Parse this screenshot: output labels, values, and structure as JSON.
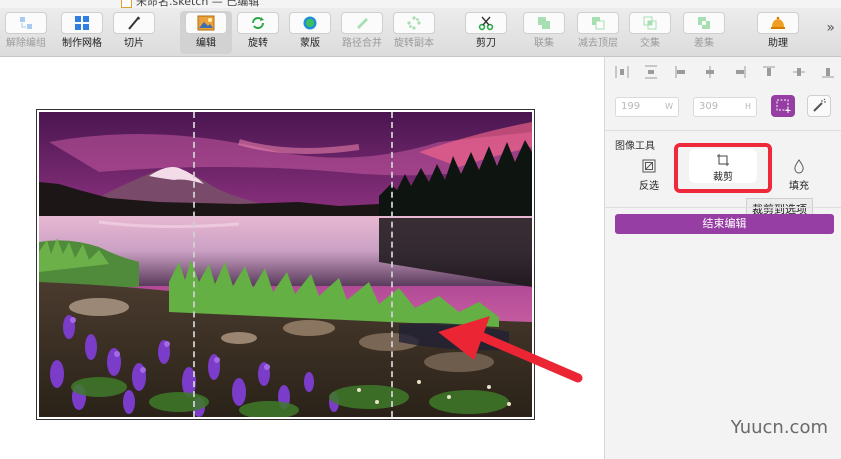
{
  "window": {
    "document_title": "未命名.sketch — 已编辑"
  },
  "toolbar": {
    "items": [
      {
        "label": "解除编组",
        "icon": "ungroup-icon",
        "enabled": false
      },
      {
        "label": "制作网格",
        "icon": "make-grid-icon",
        "enabled": true
      },
      {
        "label": "切片",
        "icon": "slice-icon",
        "enabled": true
      },
      {
        "label": "编辑",
        "icon": "edit-image-icon",
        "enabled": true,
        "active": true
      },
      {
        "label": "旋转",
        "icon": "rotate-icon",
        "enabled": true
      },
      {
        "label": "蒙版",
        "icon": "mask-icon",
        "enabled": true
      },
      {
        "label": "路径合并",
        "icon": "flatten-icon",
        "enabled": false
      },
      {
        "label": "旋转副本",
        "icon": "rotate-copies-icon",
        "enabled": false
      },
      {
        "label": "剪刀",
        "icon": "scissors-icon",
        "enabled": true
      },
      {
        "label": "联集",
        "icon": "union-icon",
        "enabled": false
      },
      {
        "label": "减去顶层",
        "icon": "subtract-icon",
        "enabled": false
      },
      {
        "label": "交集",
        "icon": "intersect-icon",
        "enabled": false
      },
      {
        "label": "差集",
        "icon": "difference-icon",
        "enabled": false
      },
      {
        "label": "助理",
        "icon": "assistant-bell-icon",
        "enabled": true
      }
    ],
    "more": "»"
  },
  "inspector": {
    "width_value": "199",
    "width_unit": "W",
    "height_value": "309",
    "height_unit": "H",
    "image_tools_title": "图像工具",
    "tools": {
      "invert_label": "反选",
      "crop_label": "裁剪",
      "fill_label": "填充"
    },
    "crop_tooltip": "裁剪到选项",
    "finish_button": "结束编辑"
  },
  "watermark": "Yuucn.com",
  "colors": {
    "accent_purple": "#963ea3",
    "highlight_red": "#ee2a3a",
    "arrow_red": "#ec2535"
  }
}
